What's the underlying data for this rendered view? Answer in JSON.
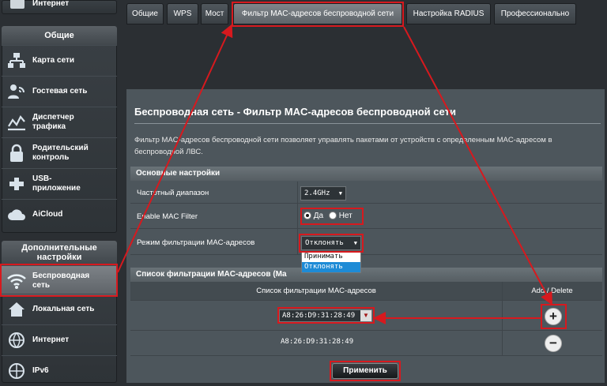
{
  "sidebar": {
    "top_item_label": "Интернет",
    "general_header": "Общие",
    "general_items": [
      {
        "label": "Карта сети",
        "icon": "network-map-icon"
      },
      {
        "label": "Гостевая сеть",
        "icon": "guest-network-icon"
      },
      {
        "label": "Диспетчер\nтрафика",
        "icon": "traffic-manager-icon"
      },
      {
        "label": "Родительский\nконтроль",
        "icon": "parental-control-icon"
      },
      {
        "label": "USB-\nприложение",
        "icon": "usb-icon"
      },
      {
        "label": "AiCloud",
        "icon": "cloud-icon"
      }
    ],
    "advanced_header": "Дополнительные\nнастройки",
    "advanced_items": [
      {
        "label": "Беспроводная\nсеть",
        "icon": "wifi-icon",
        "active": true
      },
      {
        "label": "Локальная сеть",
        "icon": "home-icon"
      },
      {
        "label": "Интернет",
        "icon": "globe-icon"
      },
      {
        "label": "IPv6",
        "icon": "ipv6-icon"
      }
    ]
  },
  "tabs": [
    {
      "label": "Общие"
    },
    {
      "label": "WPS"
    },
    {
      "label": "Мост"
    },
    {
      "label": "Фильтр MAC-адресов беспроводной сети",
      "active": true
    },
    {
      "label": "Настройка RADIUS"
    },
    {
      "label": "Профессионально"
    }
  ],
  "page": {
    "title": "Беспроводная сеть - Фильтр MAC-адресов беспроводной сети",
    "description": "Фильтр MAC-адресов беспроводной сети позволяет управлять пакетами от устройств с определенным MAC-адресом в беспроводной ЛВС."
  },
  "basic": {
    "header": "Основные настройки",
    "band_label": "Частотный диапазон",
    "band_value": "2.4GHz",
    "enable_label": "Enable MAC Filter",
    "yes_label": "Да",
    "no_label": "Нет",
    "mode_label": "Режим фильтрации MAC-адресов",
    "mode_value": "Отклонять",
    "mode_options": [
      "Принимать",
      "Отклонять"
    ]
  },
  "list": {
    "header": "Список фильтрации MAC-адресов (Ma",
    "col_mac": "Список фильтрации MAC-адресов",
    "col_action": "Add / Delete",
    "input_value": "A8:26:D9:31:28:49",
    "entries": [
      "A8:26:D9:31:28:49"
    ]
  },
  "apply_label": "Применить",
  "colors": {
    "highlight": "#d7191e",
    "selection": "#1e8bd6"
  }
}
